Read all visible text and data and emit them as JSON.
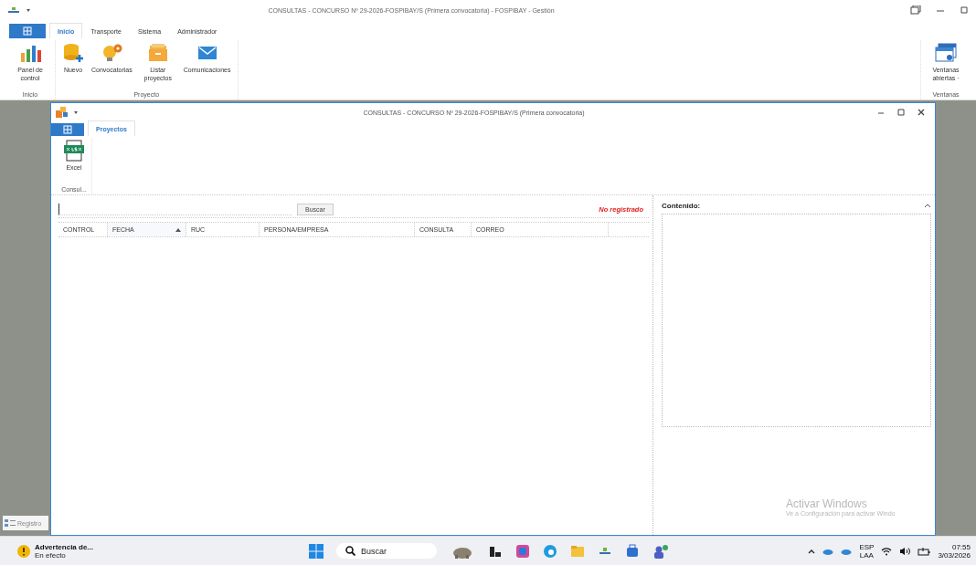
{
  "app": {
    "title": "CONSULTAS - CONCURSO Nº 29-2026-FOSPIBAY/S (Primera convocatoria) - FOSPIBAY - Gestión"
  },
  "ribbon": {
    "tabs": [
      {
        "label": "Inicio",
        "selected": true
      },
      {
        "label": "Transporte",
        "selected": false
      },
      {
        "label": "Sistema",
        "selected": false
      },
      {
        "label": "Administrador",
        "selected": false
      }
    ],
    "groups": [
      {
        "label": "Inicio",
        "buttons": [
          {
            "label": "Panel de control",
            "kind": "chart"
          }
        ]
      },
      {
        "label": "Proyecto",
        "buttons": [
          {
            "label": "Nuevo",
            "kind": "database"
          },
          {
            "label": "Convocatorias",
            "kind": "bulb"
          },
          {
            "label": "Listar proyectos",
            "kind": "folder"
          },
          {
            "label": "Comunicaciones",
            "kind": "mail"
          }
        ]
      }
    ],
    "right_group": {
      "label": "Ventanas",
      "buttons": [
        {
          "label": "Ventanas abiertas ·",
          "kind": "windows"
        }
      ]
    }
  },
  "side_panel": {
    "label": "Registro"
  },
  "child_window": {
    "title": "CONSULTAS - CONCURSO Nº 29-2026-FOSPIBAY/S (Primera convocatoria)",
    "tabs": [
      {
        "label": "Proyectos",
        "selected": true
      }
    ],
    "groups": [
      {
        "label": "Consul...",
        "buttons": [
          {
            "label": "Excel",
            "kind": "xlsx"
          }
        ]
      }
    ],
    "search": {
      "button": "Buscar"
    },
    "status": "No registrado",
    "table": {
      "columns": [
        {
          "label": "CONTROL",
          "sorted": false
        },
        {
          "label": "FECHA",
          "sorted": true
        },
        {
          "label": "RUC",
          "sorted": false
        },
        {
          "label": "PERSONA/EMPRESA",
          "sorted": false
        },
        {
          "label": "CONSULTA",
          "sorted": false
        },
        {
          "label": "CORREO",
          "sorted": false
        }
      ]
    },
    "content_label": "Contenido:"
  },
  "activation": {
    "title": "Activar Windows",
    "subtitle": "Ve a Configuración para activar Windo"
  },
  "taskbar": {
    "notification": {
      "title": "Advertencia de...",
      "subtitle": "En efecto"
    },
    "search": "Buscar",
    "apps": [
      {
        "kind": "elephant"
      },
      {
        "kind": "dark"
      },
      {
        "kind": "colorful"
      },
      {
        "kind": "edge"
      },
      {
        "kind": "folder"
      },
      {
        "kind": "app"
      },
      {
        "kind": "store"
      },
      {
        "kind": "teams"
      }
    ],
    "language": "ESP",
    "layout": "LAA",
    "time": "07:55",
    "date": "3/03/2026"
  }
}
